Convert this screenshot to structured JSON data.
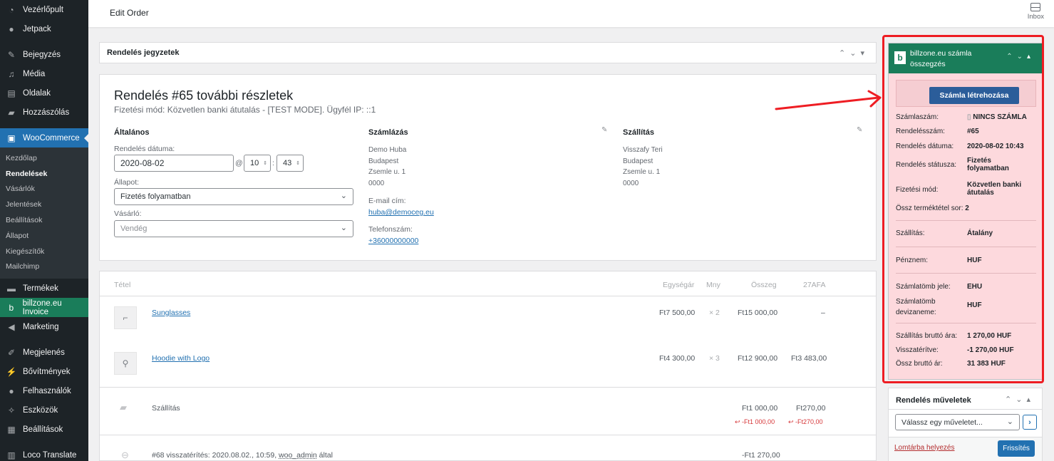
{
  "sidebar": {
    "items_top": [
      "Vezérlőpult",
      "Jetpack",
      "Bejegyzés",
      "Média",
      "Oldalak",
      "Hozzászólás",
      "WooCommerce"
    ],
    "woo_sub": [
      "Kezdőlap",
      "Rendelések",
      "Vásárlók",
      "Jelentések",
      "Beállítások",
      "Állapot",
      "Kiegészítők",
      "Mailchimp"
    ],
    "items_bottom": [
      "Termékek",
      "billzone.eu Invoice",
      "Marketing",
      "Megjelenés",
      "Bővítmények",
      "Felhasználók",
      "Eszközök",
      "Beállítások",
      "Loco Translate"
    ]
  },
  "topbar": {
    "title": "Edit Order",
    "inbox": "Inbox"
  },
  "notes": {
    "title": "Rendelés jegyzetek"
  },
  "order": {
    "heading": "Rendelés #65 további részletek",
    "subheading": "Fizetési mód: Közvetlen banki átutalás - [TEST MODE]. Ügyfél IP: ::1",
    "general": {
      "title": "Általános",
      "date_label": "Rendelés dátuma:",
      "date_value": "2020-08-02",
      "at": "@",
      "hour": "10",
      "minute": "43",
      "colon": ":",
      "status_label": "Állapot:",
      "status_value": "Fizetés folyamatban",
      "customer_label": "Vásárló:",
      "customer_placeholder": "Vendég"
    },
    "billing": {
      "title": "Számlázás",
      "name": "Demo Huba",
      "city": "Budapest",
      "street": "Zsemle u. 1",
      "zip": "0000",
      "email_label": "E-mail cím:",
      "email": "huba@democeg.eu",
      "phone_label": "Telefonszám:",
      "phone": "+36000000000"
    },
    "shipping": {
      "title": "Szállítás",
      "name": "Visszafy Teri",
      "city": "Budapest",
      "street": "Zsemle u. 1",
      "zip": "0000"
    }
  },
  "items": {
    "headers": {
      "item": "Tétel",
      "unit": "Egységár",
      "qty": "Mny",
      "total": "Összeg",
      "tax": "27AFA"
    },
    "rows": [
      {
        "name": "Sunglasses",
        "unit": "Ft7 500,00",
        "qty": "× 2",
        "total": "Ft15 000,00",
        "tax": "–"
      },
      {
        "name": "Hoodie with Logo",
        "unit": "Ft4 300,00",
        "qty": "× 3",
        "total": "Ft12 900,00",
        "tax": "Ft3 483,00"
      }
    ],
    "shipping": {
      "label": "Szállítás",
      "total": "Ft1 000,00",
      "tax": "Ft270,00",
      "refund_total": "↩ -Ft1 000,00",
      "refund_tax": "↩ -Ft270,00"
    },
    "refund": {
      "label": "#68 visszatérítés: 2020.08.02., 10:59,",
      "user": "woo_admin",
      "suffix": "által",
      "total": "-Ft1 270,00"
    }
  },
  "billzone": {
    "title_line1": "billzone.eu számla",
    "title_line2": "összegzés",
    "create_button": "Számla létrehozása",
    "rows": {
      "invoice_no_label": "Számlaszám:",
      "invoice_no_value": "NINCS SZÁMLA",
      "order_no_label": "Rendelésszám:",
      "order_no_value": "#65",
      "order_date_label": "Rendelés dátuma:",
      "order_date_value": "2020-08-02 10:43",
      "order_status_label": "Rendelés státusza:",
      "order_status_value_1": "Fizetés",
      "order_status_value_2": "folyamatban",
      "payment_label": "Fizetési mód:",
      "payment_value_1": "Közvetlen banki",
      "payment_value_2": "átutalás",
      "lines_label": "Össz terméktétel sor:",
      "lines_value": "2",
      "shipping_label": "Szállítás:",
      "shipping_value": "Átalány",
      "currency_label": "Pénznem:",
      "currency_value": "HUF",
      "block_label": "Számlatömb jele:",
      "block_value": "EHU",
      "block_cur_label_1": "Számlatömb",
      "block_cur_label_2": "devizaneme:",
      "block_cur_value": "HUF",
      "ship_gross_label": "Szállítás bruttó ára:",
      "ship_gross_value": "1 270,00 HUF",
      "refunded_label": "Visszatérítve:",
      "refunded_value": "-1 270,00 HUF",
      "total_label": "Össz bruttó ár:",
      "total_value": "31 383 HUF"
    }
  },
  "actions": {
    "title": "Rendelés műveletek",
    "select_placeholder": "Válassz egy műveletet...",
    "go": "›",
    "trash": "Lomtárba helyezés",
    "update": "Frissítés"
  },
  "colors": {
    "accent": "#2271b1",
    "billzone_green": "#1a7d5a",
    "highlight_red": "#ee1d23",
    "panel_pink": "#fdd9dd"
  }
}
